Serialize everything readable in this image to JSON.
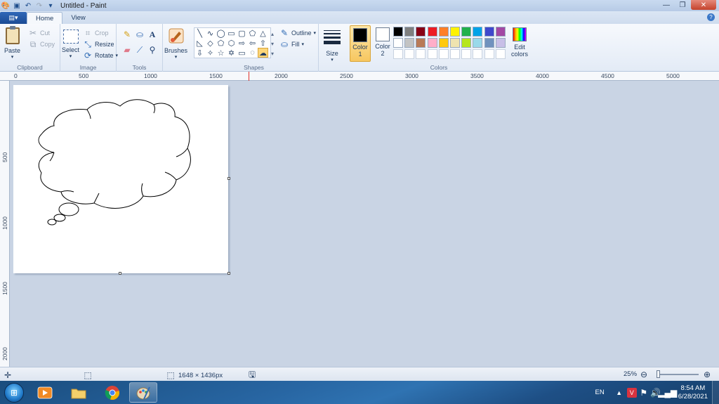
{
  "window": {
    "title": "Untitled - Paint"
  },
  "tabs": [
    {
      "label": "Home",
      "active": true
    },
    {
      "label": "View",
      "active": false
    }
  ],
  "ribbon": {
    "clipboard": {
      "paste": "Paste",
      "cut": "Cut",
      "copy": "Copy",
      "group_label": "Clipboard"
    },
    "image": {
      "select": "Select",
      "crop": "Crop",
      "resize": "Resize",
      "rotate": "Rotate",
      "group_label": "Image"
    },
    "tools": {
      "group_label": "Tools"
    },
    "brushes": {
      "label": "Brushes"
    },
    "shapes": {
      "outline": "Outline",
      "fill": "Fill",
      "group_label": "Shapes"
    },
    "size": {
      "label": "Size"
    },
    "colors": {
      "color1": "Color",
      "color1_num": "1",
      "color2": "Color",
      "color2_num": "2",
      "edit_label": "Edit",
      "edit_label2": "colors",
      "group_label": "Colors",
      "color1_value": "#000000",
      "color2_value": "#ffffff",
      "palette": [
        "#000000",
        "#7f7f7f",
        "#880015",
        "#ed1c24",
        "#ff7f27",
        "#fff200",
        "#22b14c",
        "#00a2e8",
        "#3f48cc",
        "#a349a4",
        "#ffffff",
        "#c3c3c3",
        "#b97a57",
        "#ffaec9",
        "#ffc90e",
        "#efe4b0",
        "#b5e61d",
        "#99d9ea",
        "#7092be",
        "#c8bfe7",
        "#ffffff",
        "#ffffff",
        "#ffffff",
        "#ffffff",
        "#ffffff",
        "#ffffff",
        "#ffffff",
        "#ffffff",
        "#ffffff",
        "#ffffff"
      ]
    }
  },
  "ruler": {
    "h_labels": [
      "0",
      "500",
      "1000",
      "1500",
      "2000",
      "2500",
      "3000",
      "3500",
      "4000",
      "4500",
      "5000"
    ],
    "v_labels": [
      "500",
      "1000",
      "1500",
      "2000"
    ]
  },
  "statusbar": {
    "dimensions": "1648 × 1436px",
    "zoom": "25%"
  },
  "taskbar": {
    "language": "EN",
    "time": "8:54 AM",
    "date": "6/28/2021"
  }
}
